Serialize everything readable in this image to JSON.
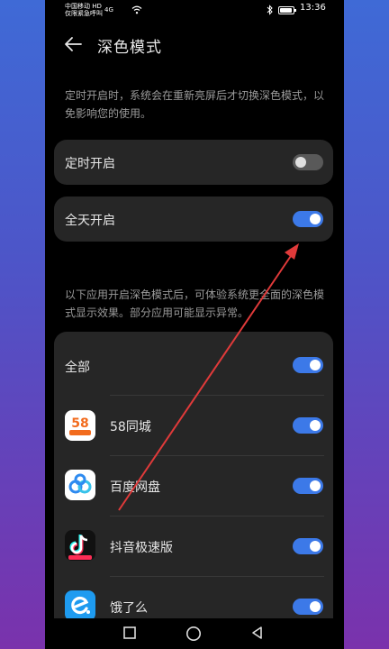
{
  "status_bar": {
    "carrier_line1": "中国移动 HD",
    "carrier_line2": "仅限紧急呼叫",
    "signal": "4G",
    "time": "13:36"
  },
  "header": {
    "title": "深色模式"
  },
  "schedule_desc": "定时开启时，系统会在重新亮屏后才切换深色模式，以免影响您的使用。",
  "settings": {
    "scheduled_label": "定时开启",
    "scheduled_on": false,
    "allday_label": "全天开启",
    "allday_on": true
  },
  "apps_desc": "以下应用开启深色模式后，可体验系统更全面的深色模式显示效果。部分应用可能显示异常。",
  "apps": {
    "all_label": "全部",
    "all_on": true,
    "items": [
      {
        "name": "58同城",
        "icon": "58-icon",
        "on": true
      },
      {
        "name": "百度网盘",
        "icon": "baidu-netdisk-icon",
        "on": true
      },
      {
        "name": "抖音极速版",
        "icon": "douyin-icon",
        "on": true
      },
      {
        "name": "饿了么",
        "icon": "eleme-icon",
        "on": true
      }
    ]
  },
  "colors": {
    "toggle_on": "#3c79e8",
    "card_bg": "#262626",
    "annotation_arrow": "#e03a3a"
  }
}
